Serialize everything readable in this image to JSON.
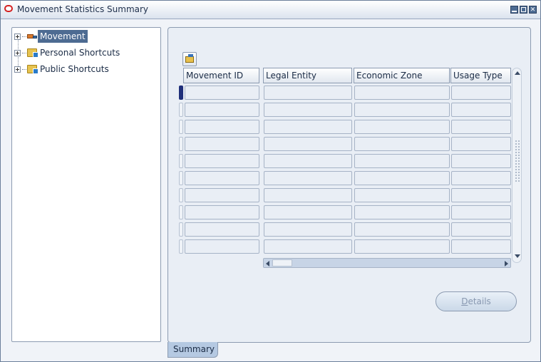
{
  "window": {
    "title": "Movement Statistics Summary"
  },
  "tree": {
    "items": [
      {
        "label": "Movement",
        "icon": "truck-icon",
        "selected": true
      },
      {
        "label": "Personal Shortcuts",
        "icon": "folder-icon"
      },
      {
        "label": "Public Shortcuts",
        "icon": "folder-icon"
      }
    ]
  },
  "table": {
    "columns": [
      "Movement ID",
      "Legal Entity",
      "Economic Zone",
      "Usage Type"
    ],
    "row_count": 10,
    "rows": []
  },
  "buttons": {
    "details_mnemonic": "D",
    "details_rest": "etails"
  },
  "tabs": {
    "summary": "Summary"
  },
  "colors": {
    "accent": "#4d6b92",
    "panel_bg": "#e9eef5",
    "current_row": "#1f2f7a"
  }
}
